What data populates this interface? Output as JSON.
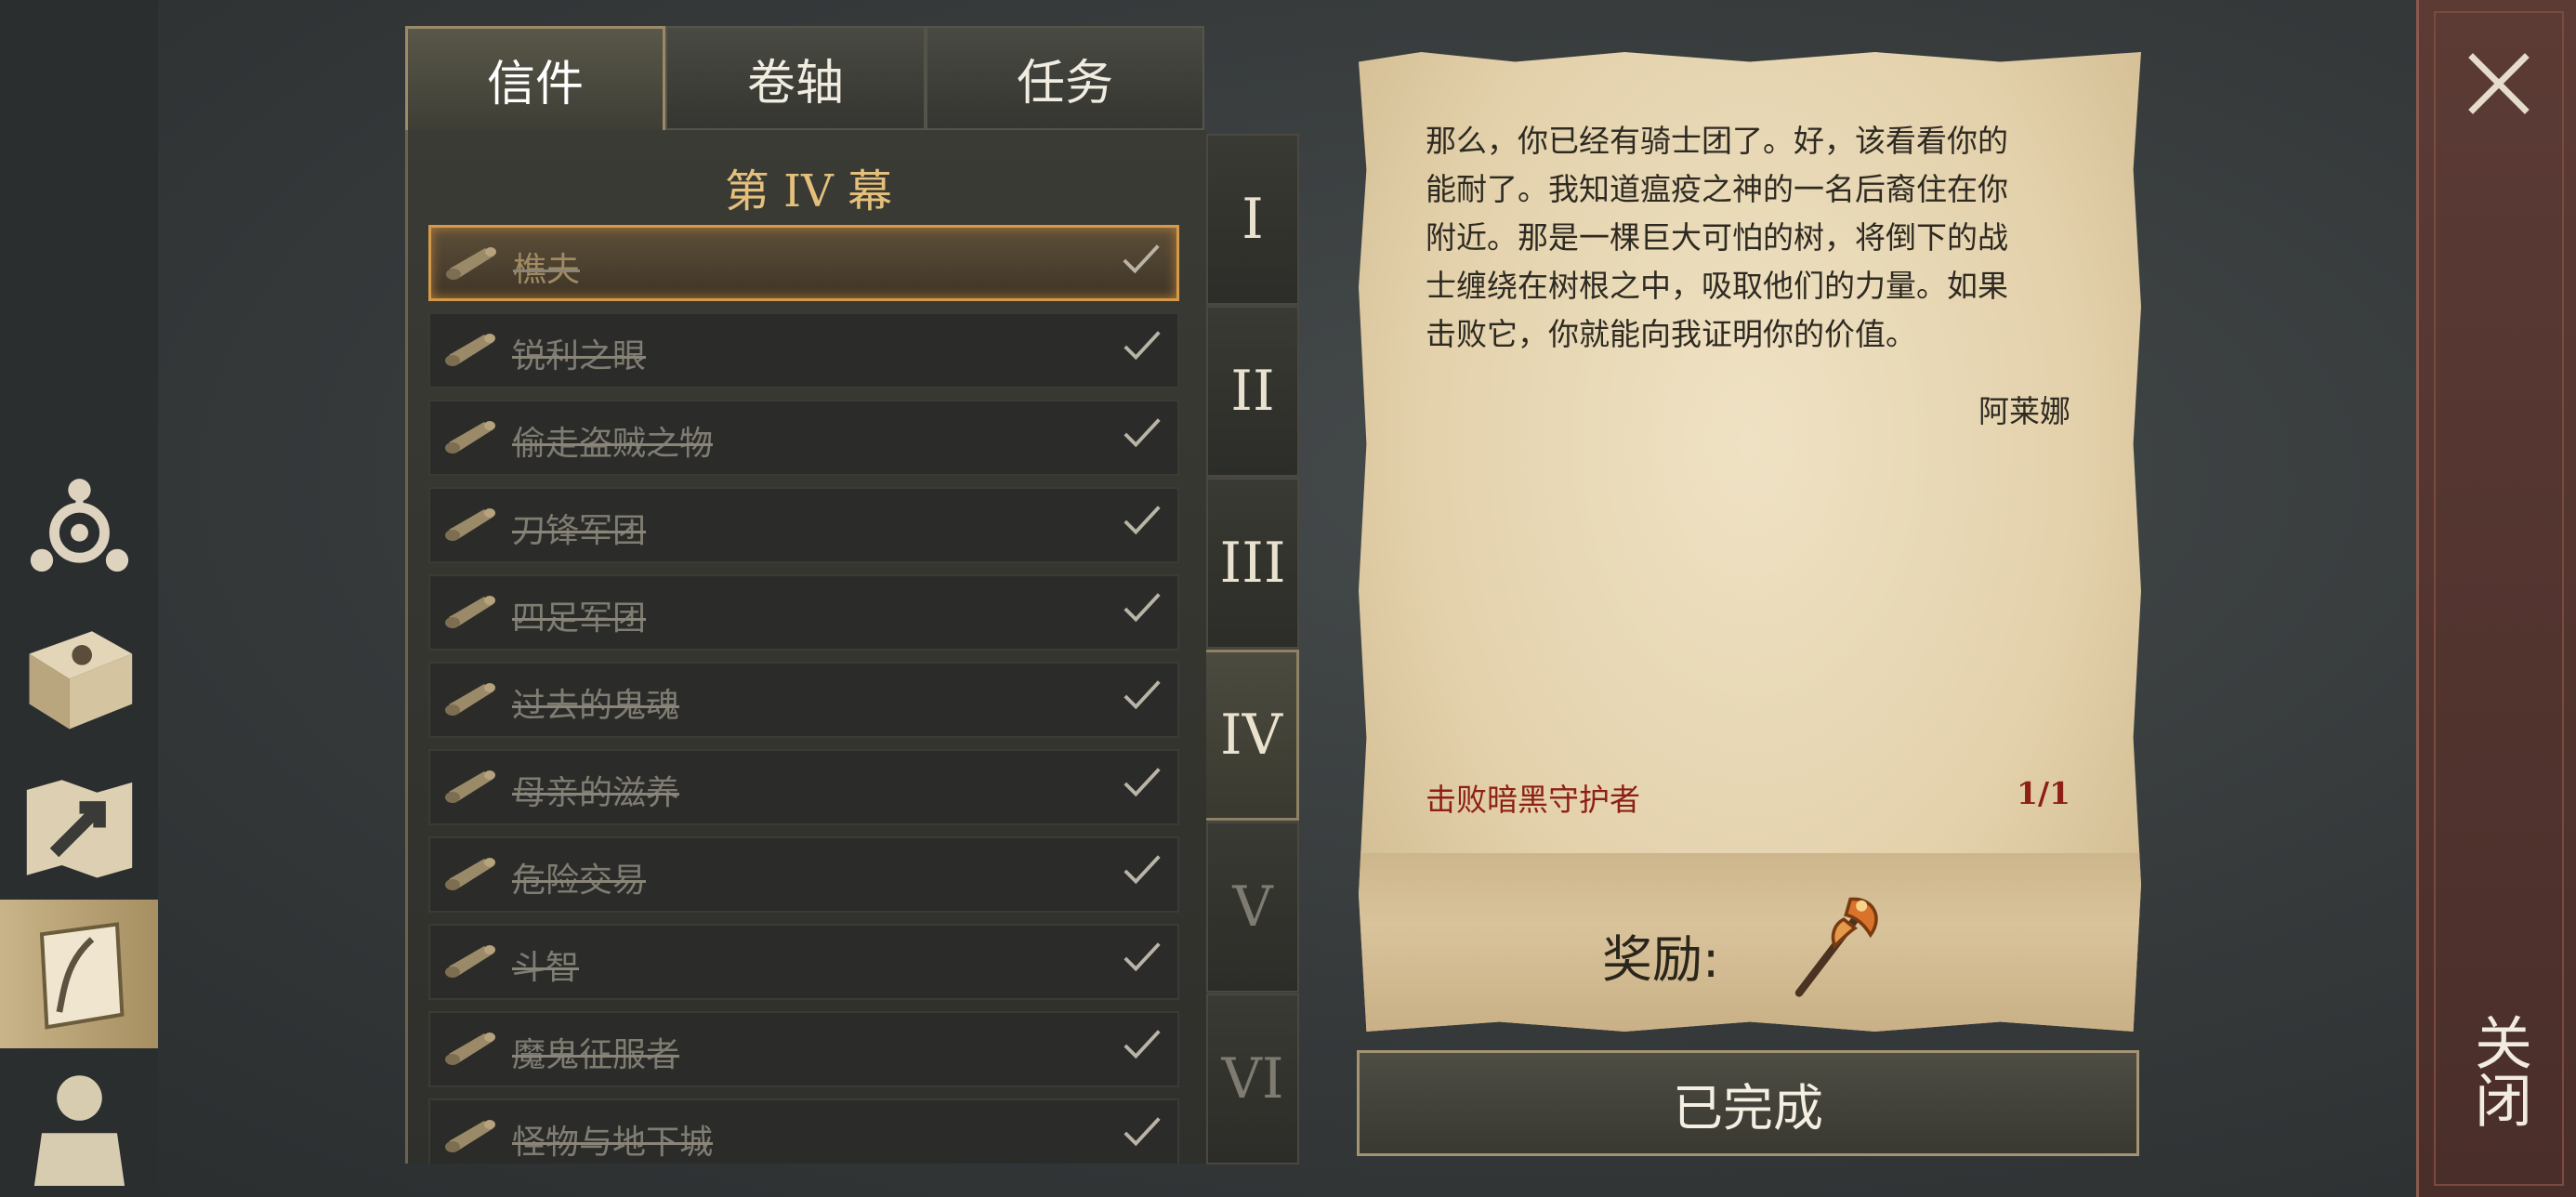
{
  "tabs": [
    {
      "label": "信件"
    },
    {
      "label": "卷轴"
    },
    {
      "label": "任务"
    }
  ],
  "list": {
    "act_title": "第 IV 幕",
    "items": [
      {
        "label": "樵夫",
        "selected": true,
        "done": true
      },
      {
        "label": "锐利之眼",
        "done": true
      },
      {
        "label": "偷走盗贼之物",
        "done": true
      },
      {
        "label": "刀锋军团",
        "done": true
      },
      {
        "label": "四足军团",
        "done": true
      },
      {
        "label": "过去的鬼魂",
        "done": true
      },
      {
        "label": "母亲的滋养",
        "done": true
      },
      {
        "label": "危险交易",
        "done": true
      },
      {
        "label": "斗智",
        "done": true
      },
      {
        "label": "魔鬼征服者",
        "done": true
      },
      {
        "label": "怪物与地下城",
        "done": true
      }
    ]
  },
  "acts": [
    {
      "label": "I"
    },
    {
      "label": "II"
    },
    {
      "label": "III"
    },
    {
      "label": "IV",
      "active": true
    },
    {
      "label": "V"
    },
    {
      "label": "VI"
    }
  ],
  "letter": {
    "lines": [
      "那么，你已经有骑士团了。好，该看看你的",
      "能耐了。我知道瘟疫之神的一名后裔住在你",
      "附近。那是一棵巨大可怕的树，将倒下的战",
      "士缠绕在树根之中，吸取他们的力量。如果",
      "击败它，你就能向我证明你的价值。"
    ],
    "signature": "阿莱娜",
    "objective": "击败暗黑守护者",
    "objective_count": "1/1",
    "reward_label": "奖励:",
    "reward_icon": "axe-icon"
  },
  "complete_button": "已完成",
  "close": {
    "label": "关闭"
  }
}
